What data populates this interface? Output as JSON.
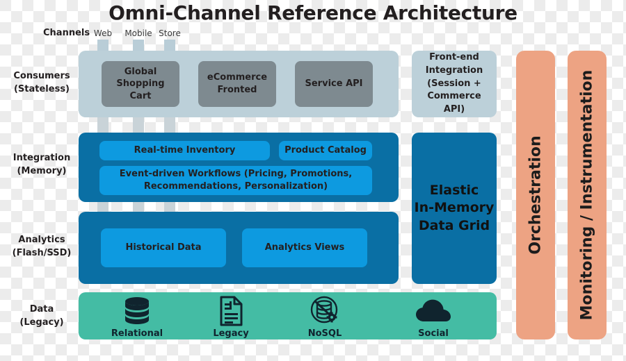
{
  "title": "Omni-Channel Reference Architecture",
  "channels": {
    "label": "Channels",
    "items": [
      "Web",
      "Mobile",
      "Store"
    ]
  },
  "rows": [
    {
      "key": "consumers",
      "label_line1": "Consumers",
      "label_line2": "(Stateless)"
    },
    {
      "key": "integration",
      "label_line1": "Integration",
      "label_line2": "(Memory)"
    },
    {
      "key": "analytics",
      "label_line1": "Analytics",
      "label_line2": "(Flash/SSD)"
    },
    {
      "key": "data",
      "label_line1": "Data",
      "label_line2": "(Legacy)"
    }
  ],
  "consumers": {
    "tiles": [
      {
        "line1": "Global",
        "line2": "Shopping Cart"
      },
      {
        "line1": "eCommerce",
        "line2": "Fronted"
      },
      {
        "line1": "Service API",
        "line2": ""
      }
    ]
  },
  "integration": {
    "tiles": [
      {
        "line1": "Real-time Inventory",
        "line2": ""
      },
      {
        "line1": "Product Catalog",
        "line2": ""
      },
      {
        "line1": "Event-driven Workflows (Pricing, Promotions,",
        "line2": "Recommendations, Personalization)"
      }
    ]
  },
  "analytics": {
    "tiles": [
      {
        "line1": "Historical Data",
        "line2": ""
      },
      {
        "line1": "Analytics Views",
        "line2": ""
      }
    ]
  },
  "data": {
    "items": [
      {
        "caption": "Relational",
        "icon": "database-stack-icon"
      },
      {
        "caption": "Legacy",
        "icon": "document-chart-icon"
      },
      {
        "caption": "NoSQL",
        "icon": "nosql-database-gear-icon"
      },
      {
        "caption": "Social",
        "icon": "cloud-icon"
      }
    ]
  },
  "frontend_integration": {
    "line1": "Front-end",
    "line2": "Integration",
    "line3": "(Session +",
    "line4": "Commerce API)"
  },
  "data_grid": {
    "line1": "Elastic",
    "line2": "In-Memory",
    "line3": "Data Grid"
  },
  "vertical_bars": [
    {
      "label": "Orchestration"
    },
    {
      "label": "Monitoring / Instrumentation"
    }
  ],
  "colors": {
    "consumers_band": "#bcd0d9",
    "consumers_tile": "#7e8a90",
    "blue_band": "#0a6fa4",
    "blue_tile": "#0d9ae0",
    "data_band": "#44bca4",
    "vertical_bar": "#eda383",
    "icon_dark": "#10242e"
  }
}
